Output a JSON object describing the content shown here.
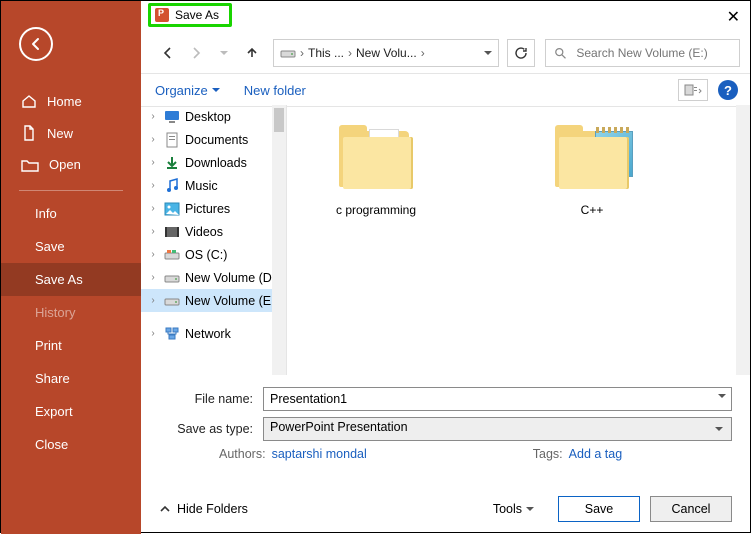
{
  "backstage": {
    "home": "Home",
    "new": "New",
    "open": "Open",
    "items": [
      {
        "label": "Info"
      },
      {
        "label": "Save"
      },
      {
        "label": "Save As",
        "selected": true
      },
      {
        "label": "History",
        "disabled": true
      },
      {
        "label": "Print"
      },
      {
        "label": "Share"
      },
      {
        "label": "Export"
      },
      {
        "label": "Close"
      }
    ]
  },
  "dialog": {
    "title": "Save As",
    "breadcrumb": {
      "seg1": "This ...",
      "seg2": "New Volu..."
    },
    "search_placeholder": "Search New Volume (E:)",
    "organize": "Organize",
    "new_folder": "New folder",
    "tree": [
      {
        "label": "Desktop",
        "icon": "desktop"
      },
      {
        "label": "Documents",
        "icon": "documents"
      },
      {
        "label": "Downloads",
        "icon": "downloads"
      },
      {
        "label": "Music",
        "icon": "music"
      },
      {
        "label": "Pictures",
        "icon": "pictures"
      },
      {
        "label": "Videos",
        "icon": "videos"
      },
      {
        "label": "OS (C:)",
        "icon": "drive"
      },
      {
        "label": "New Volume (D:)",
        "icon": "drive"
      },
      {
        "label": "New Volume (E:)",
        "icon": "drive",
        "selected": true
      },
      {
        "label": "Network",
        "icon": "network"
      }
    ],
    "folders": [
      {
        "label": "c programming",
        "kind": "docs"
      },
      {
        "label": "C++",
        "kind": "notes"
      }
    ],
    "file_name_label": "File name:",
    "file_name_value": "Presentation1",
    "type_label": "Save as type:",
    "type_value": "PowerPoint Presentation",
    "authors_label": "Authors:",
    "authors_value": "saptarshi mondal",
    "tags_label": "Tags:",
    "tags_value": "Add a tag",
    "hide_folders": "Hide Folders",
    "tools": "Tools",
    "save": "Save",
    "cancel": "Cancel"
  }
}
